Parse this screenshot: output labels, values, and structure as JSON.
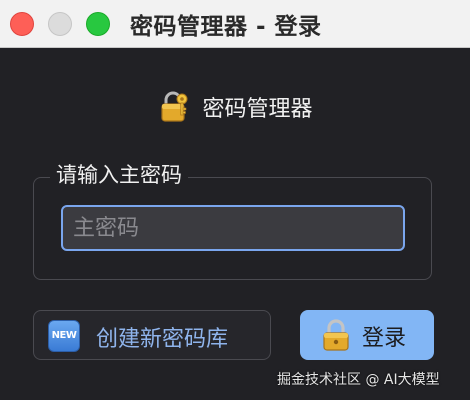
{
  "window": {
    "title": "密码管理器 - 登录"
  },
  "header": {
    "icon": "lock-with-key-icon",
    "title": "密码管理器"
  },
  "master_password": {
    "legend": "请输入主密码",
    "placeholder": "主密码",
    "value": ""
  },
  "buttons": {
    "create_icon": "new-badge-icon",
    "create_badge_text": "NEW",
    "create_label": "创建新密码库",
    "login_icon": "lock-icon",
    "login_label": "登录"
  },
  "watermark": "掘金技术社区 @ AI大模型",
  "colors": {
    "background": "#212125",
    "titlebar": "#f2f2f2",
    "accent": "#82b6f5",
    "input_focus": "#7aa6ee",
    "close": "#fe5f57",
    "maximize": "#28c840"
  }
}
